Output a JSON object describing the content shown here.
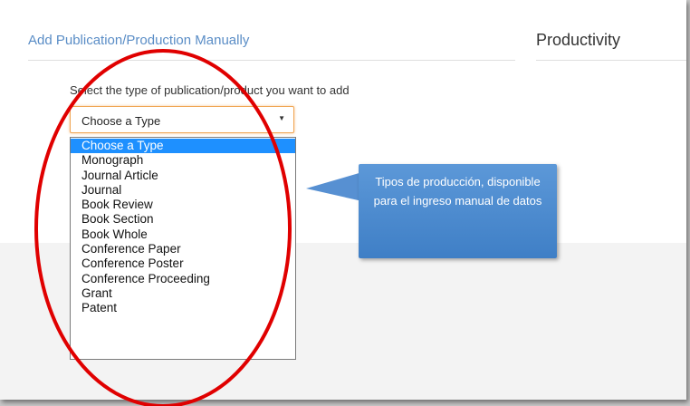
{
  "header": {
    "left_title": "Add Publication/Production Manually",
    "right_title": "Productivity"
  },
  "form": {
    "prompt": "Select the type of publication/product you want to add",
    "select_value": "Choose a Type",
    "arrow_glyph": "▼",
    "options": [
      "Choose a Type",
      "Monograph",
      "Journal Article",
      "Journal",
      "Book Review",
      "Book Section",
      "Book Whole",
      "Conference Paper",
      "Conference Poster",
      "Conference Proceeding",
      "Grant",
      "Patent"
    ],
    "selected_index": 0
  },
  "callout": {
    "text": "Tipos de producción, disponible para el ingreso manual de datos"
  },
  "colors": {
    "accent_blue": "#5a8dc6",
    "select_highlight": "#1e90ff",
    "focus_orange": "#f0a552",
    "callout_blue": "#4a8ad0",
    "annotation_red": "#e00000"
  }
}
